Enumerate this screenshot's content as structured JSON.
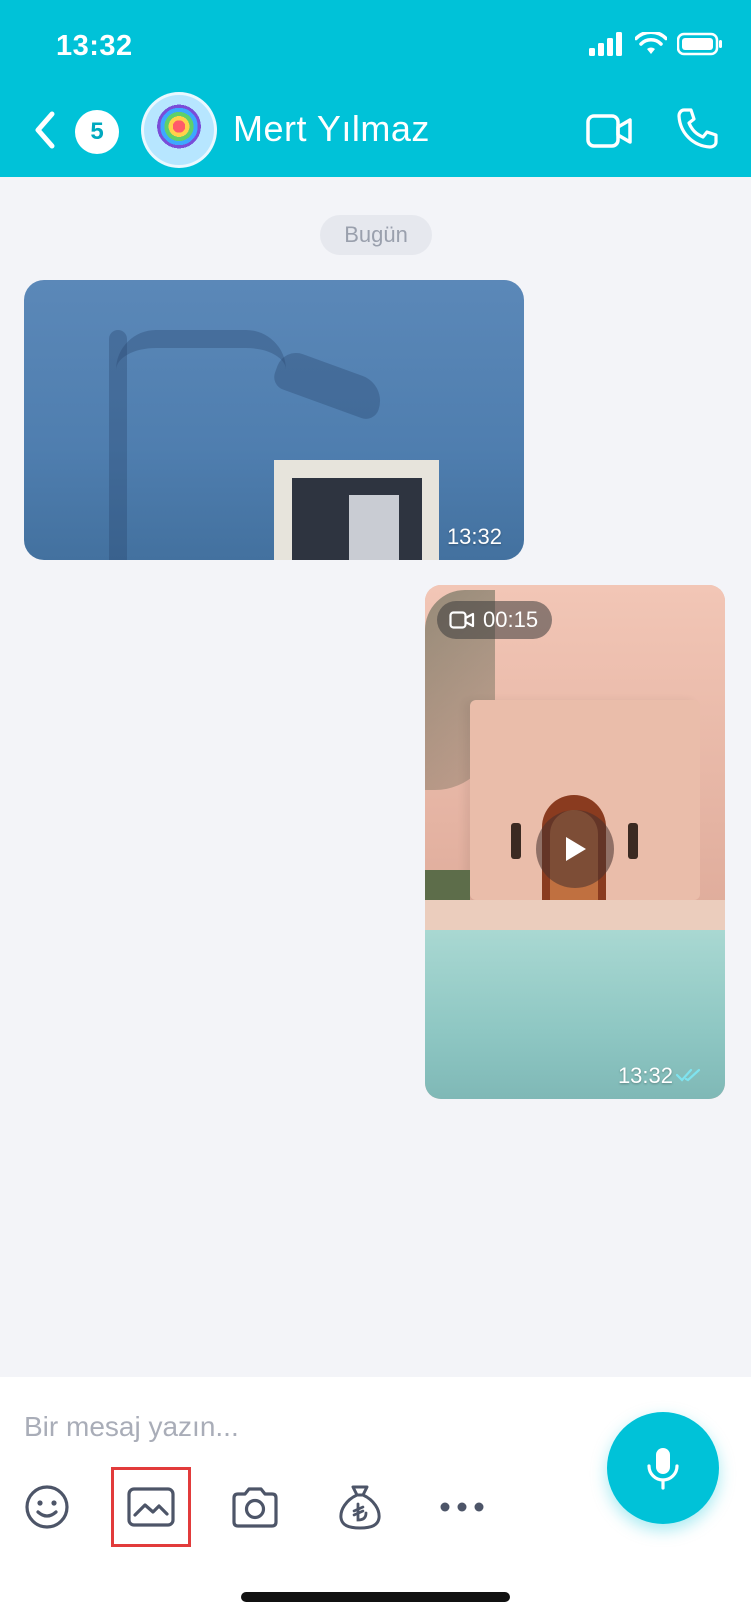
{
  "status_bar": {
    "time": "13:32"
  },
  "header": {
    "unread_count": "5",
    "contact_name": "Mert Yılmaz"
  },
  "chat": {
    "date_separator": "Bugün",
    "messages": [
      {
        "type": "image",
        "direction": "incoming",
        "time": "13:32"
      },
      {
        "type": "video",
        "direction": "outgoing",
        "duration": "00:15",
        "time": "13:32",
        "read": true
      }
    ]
  },
  "composer": {
    "placeholder": "Bir mesaj yazın...",
    "value": "",
    "tools": [
      "emoji-icon",
      "gallery-icon",
      "camera-icon",
      "money-bag-icon",
      "more-icon"
    ],
    "highlighted_tool": "gallery-icon"
  },
  "colors": {
    "accent": "#00c2d8",
    "background": "#f3f4f8",
    "highlight_box": "#e23b3b"
  }
}
